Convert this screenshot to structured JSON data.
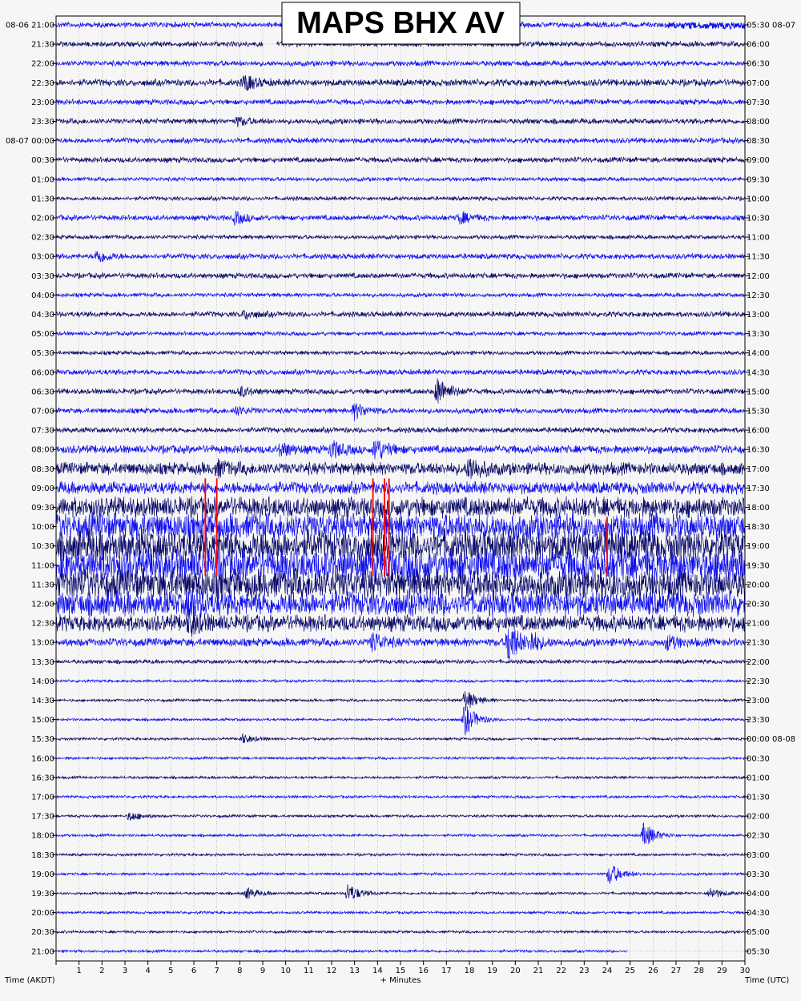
{
  "chart_data": {
    "type": "line",
    "title": "MAPS BHX AV",
    "xlabel": "+ Minutes",
    "left_axis_label": "Time (AKDT)",
    "right_axis_label": "Time (UTC)",
    "x_ticks": [
      "1",
      "2",
      "3",
      "4",
      "5",
      "6",
      "7",
      "8",
      "9",
      "10",
      "11",
      "12",
      "13",
      "14",
      "15",
      "16",
      "17",
      "18",
      "19",
      "20",
      "21",
      "22",
      "23",
      "24",
      "25",
      "26",
      "27",
      "28",
      "29",
      "30"
    ],
    "xlim": [
      0,
      30
    ],
    "minutes_per_line": 30,
    "grid": true,
    "colors": {
      "dark": "#0a0a6a",
      "blue": "#1010f0",
      "red": "#ff0000",
      "grid": "#9a9a9a"
    },
    "left_labels": [
      "08-06 21:00",
      "21:30",
      "22:00",
      "22:30",
      "23:00",
      "23:30",
      "08-07 00:00",
      "00:30",
      "01:00",
      "01:30",
      "02:00",
      "02:30",
      "03:00",
      "03:30",
      "04:00",
      "04:30",
      "05:00",
      "05:30",
      "06:00",
      "06:30",
      "07:00",
      "07:30",
      "08:00",
      "08:30",
      "09:00",
      "09:30",
      "10:00",
      "10:30",
      "11:00",
      "11:30",
      "12:00",
      "12:30",
      "13:00",
      "13:30",
      "14:00",
      "14:30",
      "15:00",
      "15:30",
      "16:00",
      "16:30",
      "17:00",
      "17:30",
      "18:00",
      "18:30",
      "19:00",
      "19:30",
      "20:00",
      "20:30",
      "21:00"
    ],
    "right_labels": [
      "05:30 08-07",
      "06:00",
      "06:30",
      "07:00",
      "07:30",
      "08:00",
      "08:30",
      "09:00",
      "09:30",
      "10:00",
      "10:30",
      "11:00",
      "11:30",
      "12:00",
      "12:30",
      "13:00",
      "13:30",
      "14:00",
      "14:30",
      "15:00",
      "15:30",
      "16:00",
      "16:30",
      "17:00",
      "17:30",
      "18:00",
      "18:30",
      "19:00",
      "19:30",
      "20:00",
      "20:30",
      "21:00",
      "21:30",
      "22:00",
      "22:30",
      "23:00",
      "23:30",
      "00:00 08-08",
      "00:30",
      "01:00",
      "01:30",
      "02:00",
      "02:30",
      "03:00",
      "03:30",
      "04:00",
      "04:30",
      "05:00",
      "05:30"
    ],
    "amplitude": [
      4,
      4,
      4,
      5,
      4,
      4,
      4,
      4,
      3,
      3,
      4,
      3,
      4,
      4,
      3,
      4,
      3,
      3,
      4,
      4,
      4,
      4,
      6,
      9,
      9,
      15,
      19,
      23,
      24,
      22,
      18,
      12,
      6,
      3,
      2,
      2,
      2,
      2,
      2,
      2,
      2,
      2,
      2,
      2,
      2,
      2,
      2,
      2,
      2
    ],
    "data_end_minutes": [
      30,
      30,
      30,
      30,
      30,
      30,
      30,
      30,
      30,
      30,
      30,
      30,
      30,
      30,
      30,
      30,
      30,
      30,
      30,
      30,
      30,
      30,
      30,
      30,
      30,
      30,
      30,
      30,
      30,
      30,
      30,
      30,
      30,
      30,
      30,
      30,
      30,
      30,
      30,
      30,
      30,
      30,
      30,
      30,
      30,
      30,
      30,
      30,
      24.9
    ],
    "events": [
      {
        "line": 0,
        "minute": 26.5,
        "type": "offset_segment",
        "end": 30
      },
      {
        "line": 1,
        "minute": 9.0,
        "type": "gap",
        "end": 9.6
      },
      {
        "line": 3,
        "minute": 8.2,
        "amp": 10
      },
      {
        "line": 5,
        "minute": 7.9,
        "amp": 5
      },
      {
        "line": 10,
        "minute": 7.8,
        "amp": 7
      },
      {
        "line": 10,
        "minute": 17.6,
        "amp": 7
      },
      {
        "line": 12,
        "minute": 1.8,
        "amp": 8
      },
      {
        "line": 15,
        "minute": 8.2,
        "amp": 5
      },
      {
        "line": 19,
        "minute": 16.6,
        "amp": 18
      },
      {
        "line": 19,
        "minute": 8.0,
        "amp": 6
      },
      {
        "line": 20,
        "minute": 13.0,
        "amp": 10
      },
      {
        "line": 20,
        "minute": 7.8,
        "amp": 5
      },
      {
        "line": 22,
        "minute": 13.9,
        "amp": 14
      },
      {
        "line": 22,
        "minute": 12.0,
        "amp": 10
      },
      {
        "line": 22,
        "minute": 9.8,
        "amp": 8
      },
      {
        "line": 23,
        "minute": 18.0,
        "amp": 14
      },
      {
        "line": 23,
        "minute": 7.0,
        "amp": 8
      },
      {
        "line": 30,
        "minute": 5.8,
        "amp": 12
      },
      {
        "line": 31,
        "minute": 5.8,
        "amp": 12
      },
      {
        "line": 32,
        "minute": 19.7,
        "amp": 28
      },
      {
        "line": 32,
        "minute": 13.8,
        "amp": 12
      },
      {
        "line": 32,
        "minute": 20.7,
        "amp": 10
      },
      {
        "line": 32,
        "minute": 26.6,
        "amp": 8
      },
      {
        "line": 35,
        "minute": 17.8,
        "amp": 14
      },
      {
        "line": 36,
        "minute": 17.8,
        "amp": 20
      },
      {
        "line": 37,
        "minute": 8.1,
        "amp": 6
      },
      {
        "line": 41,
        "minute": 3.2,
        "amp": 6
      },
      {
        "line": 42,
        "minute": 25.6,
        "amp": 16
      },
      {
        "line": 44,
        "minute": 24.1,
        "amp": 14
      },
      {
        "line": 45,
        "minute": 8.3,
        "amp": 7
      },
      {
        "line": 45,
        "minute": 12.7,
        "amp": 12
      },
      {
        "line": 45,
        "minute": 28.5,
        "amp": 7
      }
    ],
    "clip_marks": [
      {
        "line": 24,
        "minute": 6.5
      },
      {
        "line": 24,
        "minute": 7.0
      },
      {
        "line": 24,
        "minute": 13.8
      },
      {
        "line": 24,
        "minute": 14.3
      },
      {
        "line": 24,
        "minute": 14.5
      },
      {
        "line": 26,
        "minute": 6.5
      },
      {
        "line": 26,
        "minute": 7.0
      },
      {
        "line": 26,
        "minute": 13.8
      },
      {
        "line": 26,
        "minute": 14.3
      },
      {
        "line": 26,
        "minute": 14.5
      },
      {
        "line": 26,
        "minute": 24.0
      }
    ]
  }
}
